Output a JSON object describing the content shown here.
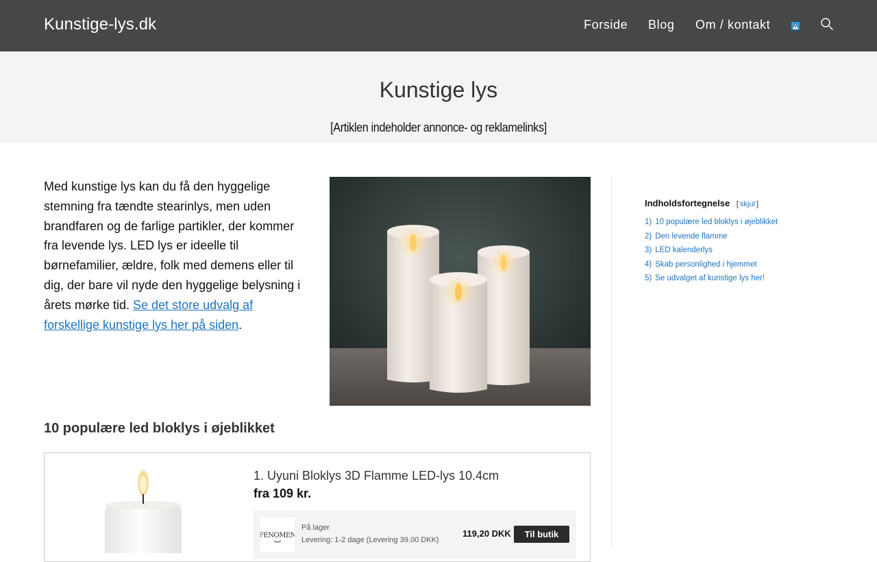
{
  "header": {
    "brand": "Kunstige-lys.dk",
    "nav": [
      {
        "label": "Forside"
      },
      {
        "label": "Blog"
      },
      {
        "label": "Om / kontakt"
      }
    ],
    "background": "#474747",
    "icons": [
      "flag-icon",
      "search-icon"
    ]
  },
  "title_band": {
    "title": "Kunstige lys",
    "disclaimer": "[Artiklen indeholder annonce- og reklamelinks]"
  },
  "intro": {
    "text": "Med kunstige lys kan du få den hyggelige stemning fra tændte stearinlys, men uden brandfaren og de farlige partikler, der kommer fra levende lys. LED lys er ideelle til børnefamilier, ældre, folk med demens eller til dig, der bare vil nyde den hyggelige belysning i årets mørke tid.",
    "link": "Se det store udvalg af forskellige kunstige lys her på siden",
    "suffix": "."
  },
  "toc": {
    "heading": "Indholdsfortegnelse",
    "toggle_open": "[",
    "toggle_label": "skjul",
    "toggle_close": "]",
    "items": [
      {
        "num": "1)",
        "label": "10 populære led bloklys i øjeblikket"
      },
      {
        "num": "2)",
        "label": "Den levende flamme"
      },
      {
        "num": "3)",
        "label": "LED kalenderlys"
      },
      {
        "num": "4)",
        "label": "Skab personlighed i hjemmet"
      },
      {
        "num": "5)",
        "label": "Se udvalget af kunstige lys her!"
      }
    ]
  },
  "section": {
    "title": "10 populære led bloklys i øjeblikket"
  },
  "products": [
    {
      "title": "1. Uyuni Bloklys 3D Flamme LED-lys 10.4cm",
      "price": "fra 109 kr.",
      "offer": {
        "shop_logo_text": "FENOMEN",
        "stock": "På lager",
        "delivery": "Levering: 1-2 dage (Levering 39.00 DKK)",
        "price": "119,20 DKK",
        "button": "Til butik"
      }
    }
  ],
  "colors": {
    "link": "#1e73be",
    "button": "#2b2b2b"
  }
}
